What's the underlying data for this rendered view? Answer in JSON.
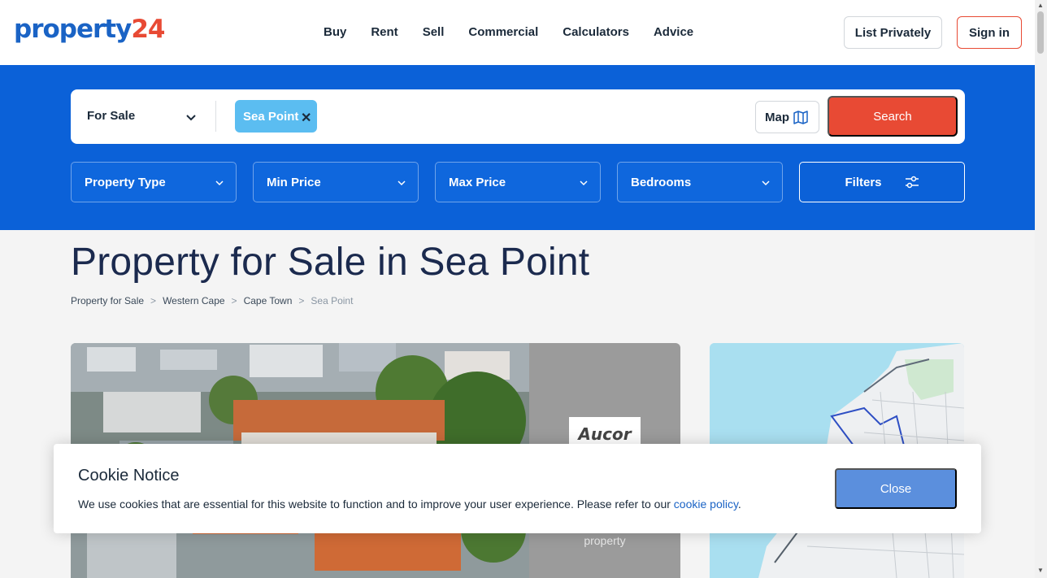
{
  "header": {
    "logo_part1": "property",
    "logo_part2": "24",
    "nav": [
      "Buy",
      "Rent",
      "Sell",
      "Commercial",
      "Calculators",
      "Advice"
    ],
    "list_privately": "List Privately",
    "sign_in": "Sign in"
  },
  "search": {
    "sale_type": "For Sale",
    "location_chip": "Sea Point",
    "map_label": "Map",
    "search_label": "Search"
  },
  "filters": {
    "property_type": "Property Type",
    "min_price": "Min Price",
    "max_price": "Max Price",
    "bedrooms": "Bedrooms",
    "filters_label": "Filters"
  },
  "page": {
    "title": "Property for Sale in Sea Point",
    "breadcrumb": [
      "Property for Sale",
      "Western Cape",
      "Cape Town",
      "Sea Point"
    ],
    "breadcrumb_sep": ">"
  },
  "listing": {
    "agency_logo": "Aucor",
    "side_text": "property"
  },
  "cookie": {
    "title": "Cookie Notice",
    "text": "We use cookies that are essential for this website to function and to improve your user experience. Please refer to our ",
    "link": "cookie policy",
    "text_end": ".",
    "close": "Close"
  },
  "colors": {
    "brand_blue": "#0b61d8",
    "brand_red": "#e84a34",
    "chip_blue": "#5bbdf1"
  }
}
